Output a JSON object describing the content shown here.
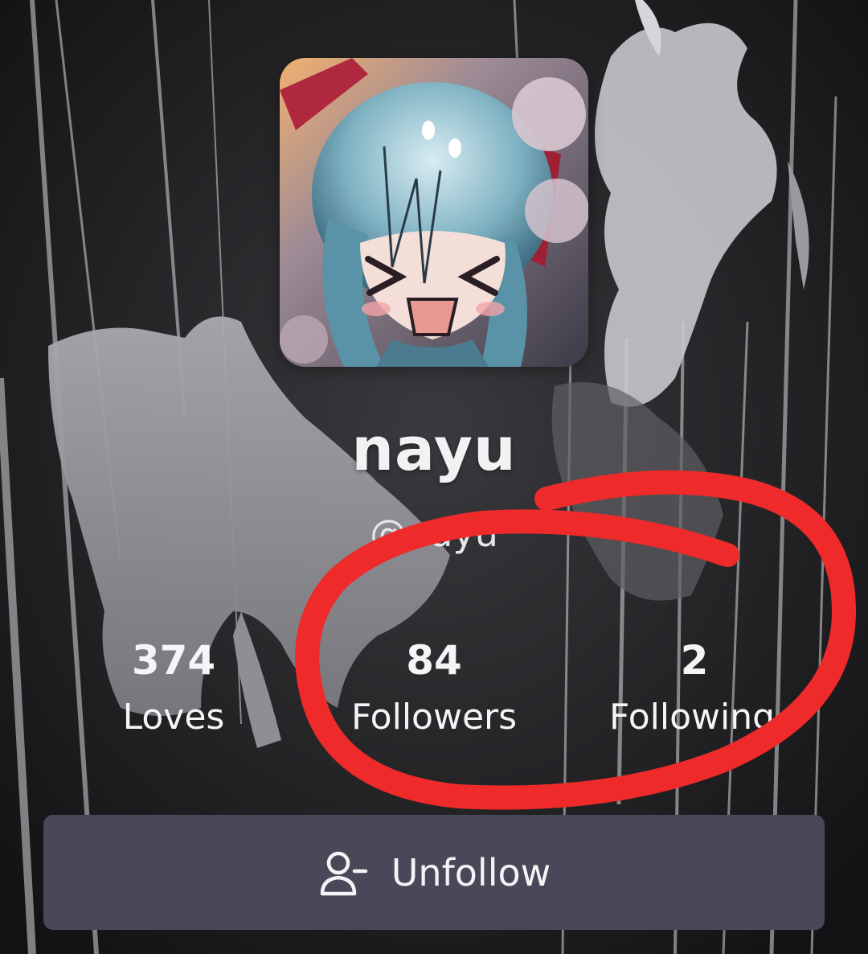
{
  "profile": {
    "display_name": "nayu",
    "handle": "@nayu"
  },
  "stats": [
    {
      "value": "374",
      "label": "Loves"
    },
    {
      "value": "84",
      "label": "Followers"
    },
    {
      "value": "2",
      "label": "Following"
    }
  ],
  "actions": {
    "unfollow_label": "Unfollow",
    "unfollow_icon": "user-minus-icon"
  },
  "colors": {
    "button_bg": "#4a4858",
    "annotation_stroke": "#ee2a2a",
    "text": "#f2f2f4"
  }
}
